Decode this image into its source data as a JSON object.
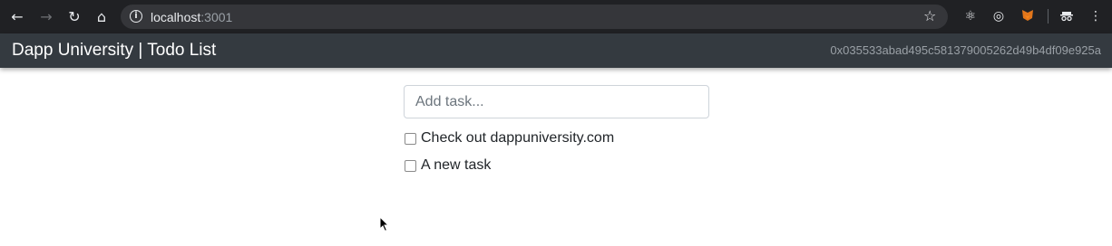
{
  "browser": {
    "url_host": "localhost",
    "url_port": ":3001"
  },
  "navbar": {
    "brand": "Dapp University | Todo List",
    "account": "0x035533abad495c581379005262d49b4df09e925a"
  },
  "form": {
    "placeholder": "Add task..."
  },
  "tasks": [
    {
      "content": "Check out dappuniversity.com",
      "completed": false
    },
    {
      "content": "A new task",
      "completed": false
    }
  ]
}
